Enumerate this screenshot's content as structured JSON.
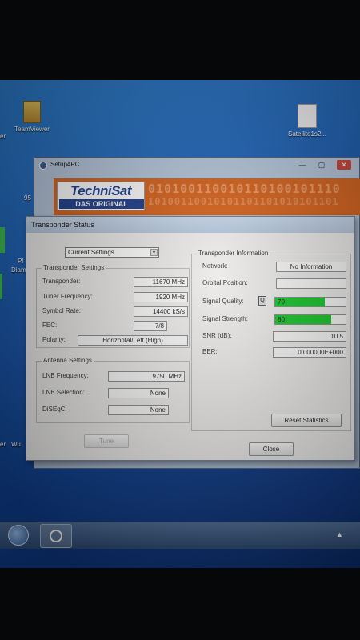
{
  "desktop": {
    "icons": [
      {
        "label": "TeamViewer"
      },
      {
        "label": "Satellite1s2..."
      }
    ],
    "left_edge_labels": [
      "er",
      "95",
      "Pl",
      "Diam",
      "er",
      "Wu"
    ],
    "right_cut_label": "Wu"
  },
  "setup_window": {
    "title": "Setup4PC",
    "minimize": "—",
    "maximize": "▢",
    "close": "✕",
    "logo_text": "TechniSat",
    "logo_tagline": "DAS ORIGINAL",
    "binary_decoration": "010100110010110100101110",
    "binary_decoration_2": "10100110010101101101010101101"
  },
  "dialog": {
    "title": "Transponder Status",
    "settings_select": {
      "value": "Current Settings",
      "arrow": "▾"
    },
    "transponder_settings": {
      "label": "Transponder Settings",
      "rows": [
        {
          "label": "Transponder:",
          "value": "11670 MHz"
        },
        {
          "label": "Tuner Frequency:",
          "value": "1920 MHz"
        },
        {
          "label": "Symbol Rate:",
          "value": "14400 kS/s"
        },
        {
          "label": "FEC:",
          "value": "7/8"
        },
        {
          "label": "Polarity:",
          "value": "Horizontal/Left (High)"
        }
      ]
    },
    "antenna_settings": {
      "label": "Antenna Settings",
      "rows": [
        {
          "label": "LNB Frequency:",
          "value": "9750 MHz"
        },
        {
          "label": "LNB Selection:",
          "value": "None"
        },
        {
          "label": "DiSEqC:",
          "value": "None"
        }
      ]
    },
    "transponder_information": {
      "label": "Transponder Information",
      "network_label": "Network:",
      "network_value": "No Information",
      "orbital_label": "Orbital Position:",
      "orbital_value": "",
      "quality_label": "Signal Quality:",
      "quality_icon": "Q",
      "quality_value": "70",
      "quality_percent": 70,
      "strength_label": "Signal Strength:",
      "strength_value": "80",
      "strength_percent": 80,
      "snr_label": "SNR (dB):",
      "snr_value": "10.5",
      "ber_label": "BER:",
      "ber_value": "0.000000E+000",
      "reset_label": "Reset Statistics"
    },
    "tune_label": "Tune",
    "close_label": "Close"
  },
  "colors": {
    "signal_bar": "#17c52a",
    "banner": "#d6621b",
    "logo_blue": "#1d3f8f"
  }
}
